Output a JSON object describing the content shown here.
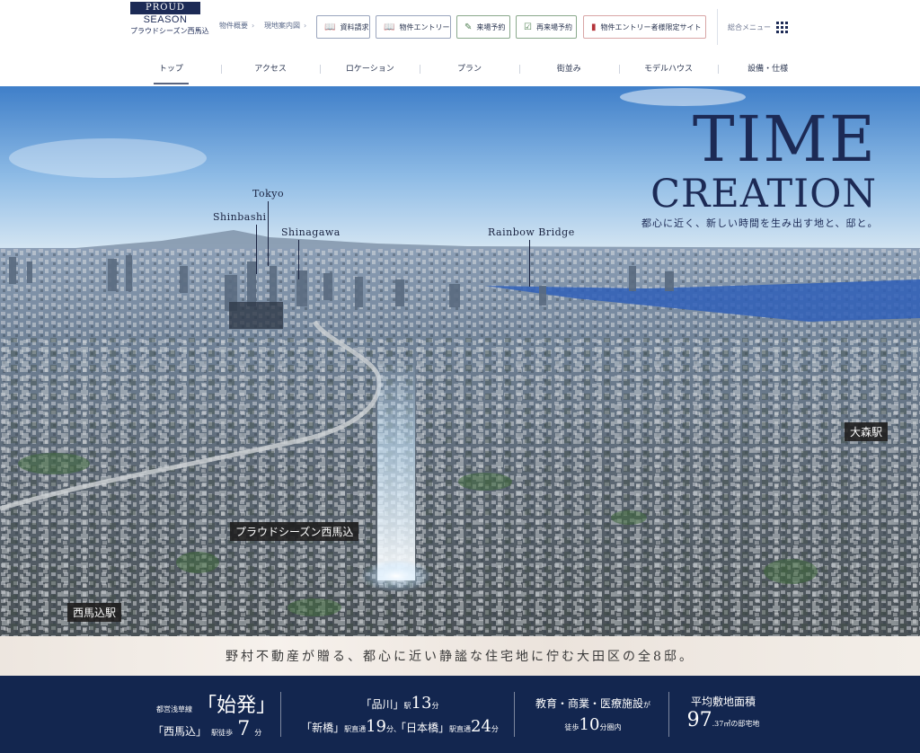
{
  "logo": {
    "line1": "PROUD",
    "line2": "SEASON",
    "line3": "プラウドシーズン西馬込"
  },
  "header": {
    "links": [
      "物件概要",
      "現地案内図"
    ],
    "buttons": [
      "資料請求",
      "物件エントリー",
      "来場予約",
      "再来場予約",
      "物件エントリー者様限定サイト"
    ],
    "menu_label": "総合メニュー"
  },
  "nav": [
    "トップ",
    "アクセス",
    "ロケーション",
    "プラン",
    "街並み",
    "モデルハウス",
    "設備・仕様"
  ],
  "nav_active": 0,
  "hero": {
    "title1": "TIME",
    "title2": "CREATION",
    "subtitle": "都心に近く、新しい時間を生み出す地と、邸と。",
    "landmarks": [
      "Tokyo",
      "Shinbashi",
      "Shinagawa",
      "Rainbow Bridge"
    ],
    "tags": {
      "site": "プラウドシーズン西馬込",
      "station_left": "西馬込駅",
      "station_right": "大森駅"
    }
  },
  "tagline": "野村不動産が贈る、都心に近い静謐な住宅地に佇む大田区の全8邸。",
  "stats": {
    "s1": {
      "small": "都営浅草線",
      "quote1": "「始発」",
      "quote2": "「西馬込」",
      "walk": "駅徒歩",
      "num": "7",
      "unit": "分"
    },
    "s2": {
      "line1a": "「品川」",
      "line1b": "駅",
      "line1num": "13",
      "line1unit": "分",
      "line2a": "「新橋」",
      "line2b": "駅直通",
      "line2num": "19",
      "line2unit": "分、",
      "line2c": "「日本橋」",
      "line2d": "駅直通",
      "line2num2": "24",
      "line2unit2": "分"
    },
    "s3": {
      "line1": "教育・商業・医療施設",
      "line1b": "が",
      "walk": "徒歩",
      "num": "10",
      "unit": "分圏内"
    },
    "s4": {
      "label": "平均敷地面積",
      "num": "97",
      "dec": ".37㎡",
      "suffix": "の邸宅地"
    }
  }
}
